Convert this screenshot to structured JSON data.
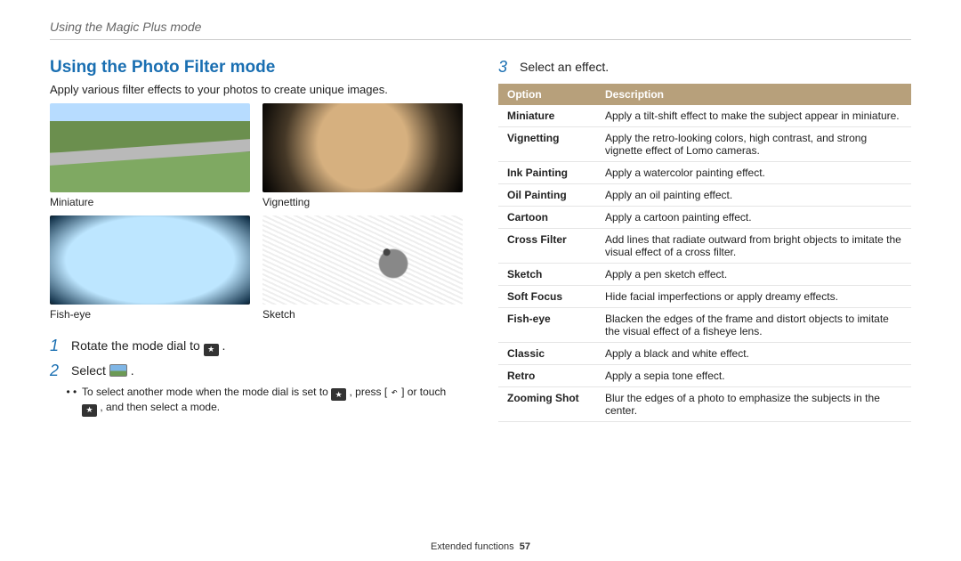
{
  "breadcrumb": "Using the Magic Plus mode",
  "section_title": "Using the Photo Filter mode",
  "lead": "Apply various filter effects to your photos to create unique images.",
  "samples": [
    {
      "label": "Miniature",
      "thumbclass": "miniature"
    },
    {
      "label": "Vignetting",
      "thumbclass": "vignetting"
    },
    {
      "label": "Fish-eye",
      "thumbclass": "fisheye"
    },
    {
      "label": "Sketch",
      "thumbclass": "sketch"
    }
  ],
  "steps": {
    "s1": {
      "num": "1",
      "text_before": "Rotate the mode dial to ",
      "text_after": " ."
    },
    "s2": {
      "num": "2",
      "text_before": "Select ",
      "text_after": " ."
    },
    "sub": "To select another mode when the mode dial is set to {star} , press [ {ret} ] or touch {star2} , and then select a mode.",
    "s3": {
      "num": "3",
      "text": "Select an effect."
    }
  },
  "table": {
    "header_option": "Option",
    "header_desc": "Description",
    "rows": [
      {
        "name": "Miniature",
        "desc": "Apply a tilt-shift effect to make the subject appear in miniature."
      },
      {
        "name": "Vignetting",
        "desc": "Apply the retro-looking colors, high contrast, and strong vignette effect of Lomo cameras."
      },
      {
        "name": "Ink Painting",
        "desc": "Apply a watercolor painting effect."
      },
      {
        "name": "Oil Painting",
        "desc": "Apply an oil painting effect."
      },
      {
        "name": "Cartoon",
        "desc": "Apply a cartoon painting effect."
      },
      {
        "name": "Cross Filter",
        "desc": "Add lines that radiate outward from bright objects to imitate the visual effect of a cross filter."
      },
      {
        "name": "Sketch",
        "desc": "Apply a pen sketch effect."
      },
      {
        "name": "Soft Focus",
        "desc": "Hide facial imperfections or apply dreamy effects."
      },
      {
        "name": "Fish-eye",
        "desc": "Blacken the edges of the frame and distort objects to imitate the visual effect of a fisheye lens."
      },
      {
        "name": "Classic",
        "desc": "Apply a black and white effect."
      },
      {
        "name": "Retro",
        "desc": "Apply a sepia tone effect."
      },
      {
        "name": "Zooming Shot",
        "desc": "Blur the edges of a photo to emphasize the subjects in the center."
      }
    ]
  },
  "footer": {
    "section": "Extended functions",
    "page": "57"
  },
  "icons": {
    "star": "★",
    "return": "↶"
  }
}
